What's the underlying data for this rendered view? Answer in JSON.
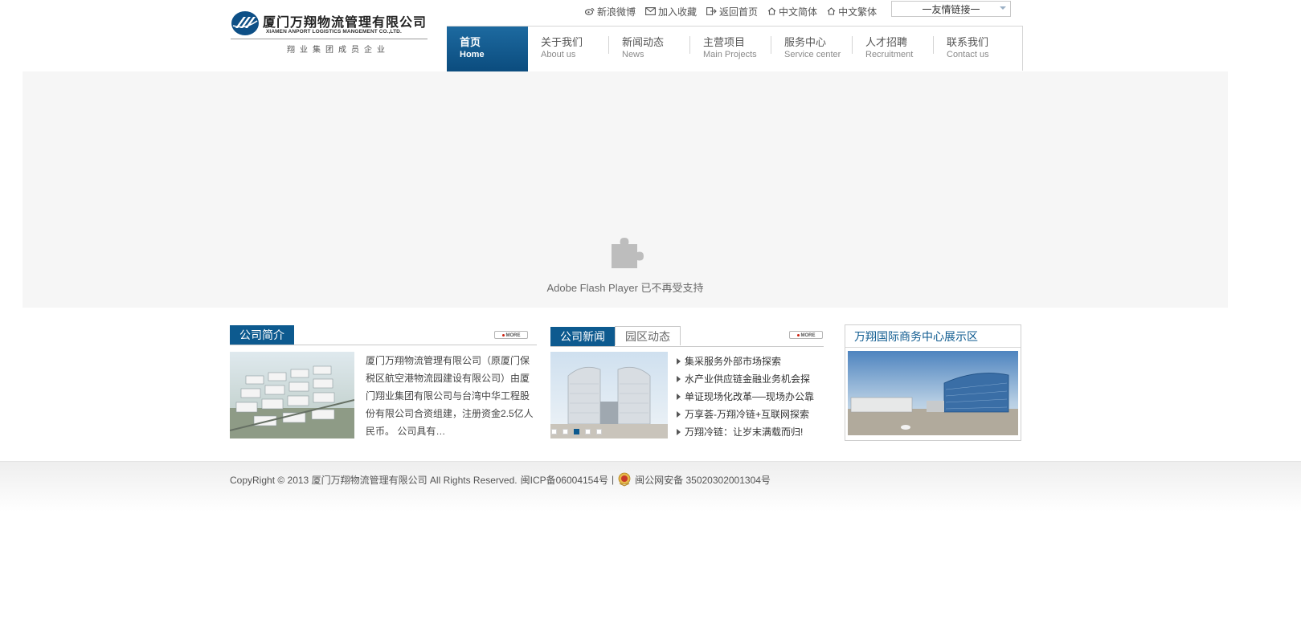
{
  "logo": {
    "name_cn": "厦门万翔物流管理有限公司",
    "name_en": "XIAMEN ANPORT LOGISTICS MANGEMENT CO.,LTD.",
    "tagline": "翔业集团成员企业"
  },
  "toplinks": [
    {
      "label": "新浪微博",
      "icon": "weibo-icon"
    },
    {
      "label": "加入收藏",
      "icon": "mail-icon"
    },
    {
      "label": "返回首页",
      "icon": "exit-icon"
    },
    {
      "label": "中文简体",
      "icon": "home-icon"
    },
    {
      "label": "中文繁体",
      "icon": "home-icon"
    }
  ],
  "friend_links": {
    "selected": "一友情链接一"
  },
  "nav": [
    {
      "cn": "首页",
      "en": "Home",
      "active": true
    },
    {
      "cn": "关于我们",
      "en": "About us"
    },
    {
      "cn": "新闻动态",
      "en": "News"
    },
    {
      "cn": "主营项目",
      "en": "Main Projects"
    },
    {
      "cn": "服务中心",
      "en": "Service center"
    },
    {
      "cn": "人才招聘",
      "en": "Recruitment"
    },
    {
      "cn": "联系我们",
      "en": "Contact us"
    }
  ],
  "flash": {
    "message": "Adobe Flash Player 已不再受支持",
    "icon": "puzzle-plugin-icon"
  },
  "intro": {
    "tab": "公司简介",
    "more": "MORE",
    "text": "厦门万翔物流管理有限公司（原厦门保税区航空港物流园建设有限公司）由厦门翔业集团有限公司与台湾中华工程股份有限公司合资组建，注册资金2.5亿人民币。 公司具有…"
  },
  "news": {
    "tab_active": "公司新闻",
    "tab_inactive": "园区动态",
    "more": "MORE",
    "items": [
      "集采服务外部市场探索",
      "水产业供应链金融业务机会探",
      "单证现场化改革──现场办公靠",
      "万享荟-万翔冷链+互联网探索",
      "万翔冷链：让岁末满载而归!"
    ],
    "slider_active": 3,
    "slider_count": 5
  },
  "showcase": {
    "title": "万翔国际商务中心展示区"
  },
  "footer": {
    "copyright": "CopyRight © 2013  厦门万翔物流管理有限公司  All Rights Reserved.",
    "icp": "闽ICP备06004154号",
    "separator": "|",
    "police": "闽公网安备 35020302001304号"
  },
  "colors": {
    "brand_blue": "#0d5a8f",
    "flash_bg": "#f6f6f6"
  }
}
